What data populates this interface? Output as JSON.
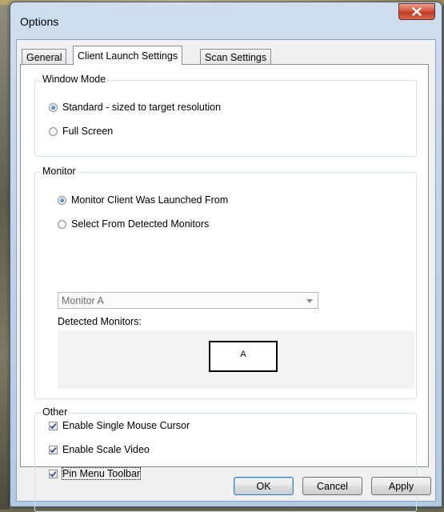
{
  "window": {
    "title": "Options"
  },
  "tabs": [
    {
      "label": "General"
    },
    {
      "label": "Client Launch Settings"
    },
    {
      "label": "Scan Settings"
    }
  ],
  "window_mode": {
    "legend": "Window Mode",
    "options": [
      {
        "label": "Standard - sized to target resolution",
        "checked": true
      },
      {
        "label": "Full Screen",
        "checked": false
      }
    ]
  },
  "monitor": {
    "legend": "Monitor",
    "options": [
      {
        "label": "Monitor Client Was Launched From",
        "checked": true
      },
      {
        "label": "Select From Detected Monitors",
        "checked": false
      }
    ],
    "dropdown_value": "Monitor A",
    "detected_label": "Detected Monitors:",
    "detected_monitors": [
      "A"
    ]
  },
  "other": {
    "legend": "Other",
    "checks": [
      {
        "label": "Enable Single Mouse Cursor",
        "checked": true
      },
      {
        "label": "Enable Scale Video",
        "checked": true
      },
      {
        "label": "Pin Menu Toolbar",
        "checked": true
      }
    ]
  },
  "buttons": {
    "ok": "OK",
    "cancel": "Cancel",
    "apply": "Apply"
  },
  "colors": {
    "check_mark": "#2d4e9c",
    "radio_dot": "#1f56b4",
    "close_button": "#c8432b"
  }
}
